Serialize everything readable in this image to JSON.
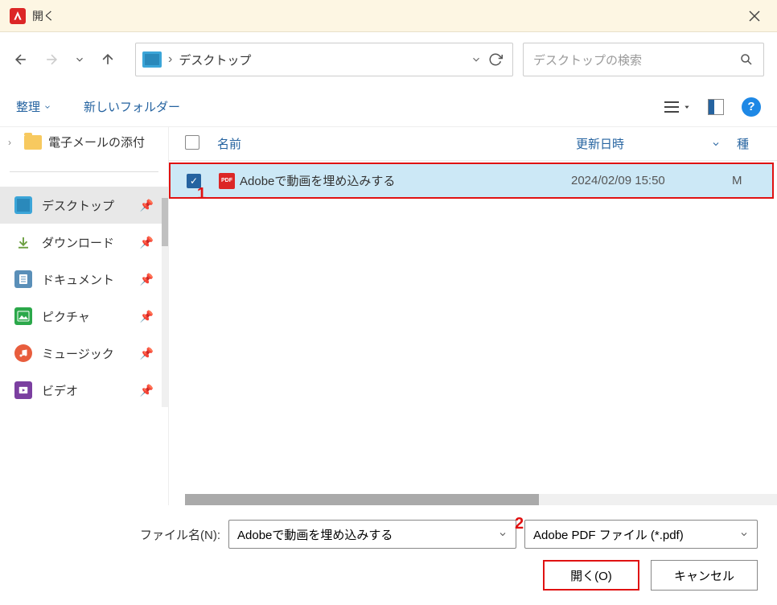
{
  "title": "開く",
  "breadcrumb": {
    "location": "デスクトップ"
  },
  "search": {
    "placeholder": "デスクトップの検索"
  },
  "toolbar": {
    "organize": "整理",
    "newfolder": "新しいフォルダー"
  },
  "tree": {
    "item1": "電子メールの添付"
  },
  "sidebar": {
    "items": [
      {
        "label": "デスクトップ"
      },
      {
        "label": "ダウンロード"
      },
      {
        "label": "ドキュメント"
      },
      {
        "label": "ピクチャ"
      },
      {
        "label": "ミュージック"
      },
      {
        "label": "ビデオ"
      }
    ]
  },
  "columns": {
    "name": "名前",
    "date": "更新日時",
    "type": "種"
  },
  "files": [
    {
      "name": "Adobeで動画を埋め込みする",
      "date": "2024/02/09 15:50",
      "type": "M"
    }
  ],
  "filename_label": "ファイル名(N):",
  "filename_value": "Adobeで動画を埋め込みする",
  "filter": "Adobe PDF ファイル (*.pdf)",
  "buttons": {
    "open": "開く(O)",
    "cancel": "キャンセル"
  },
  "callouts": {
    "c1": "1",
    "c2": "2"
  }
}
